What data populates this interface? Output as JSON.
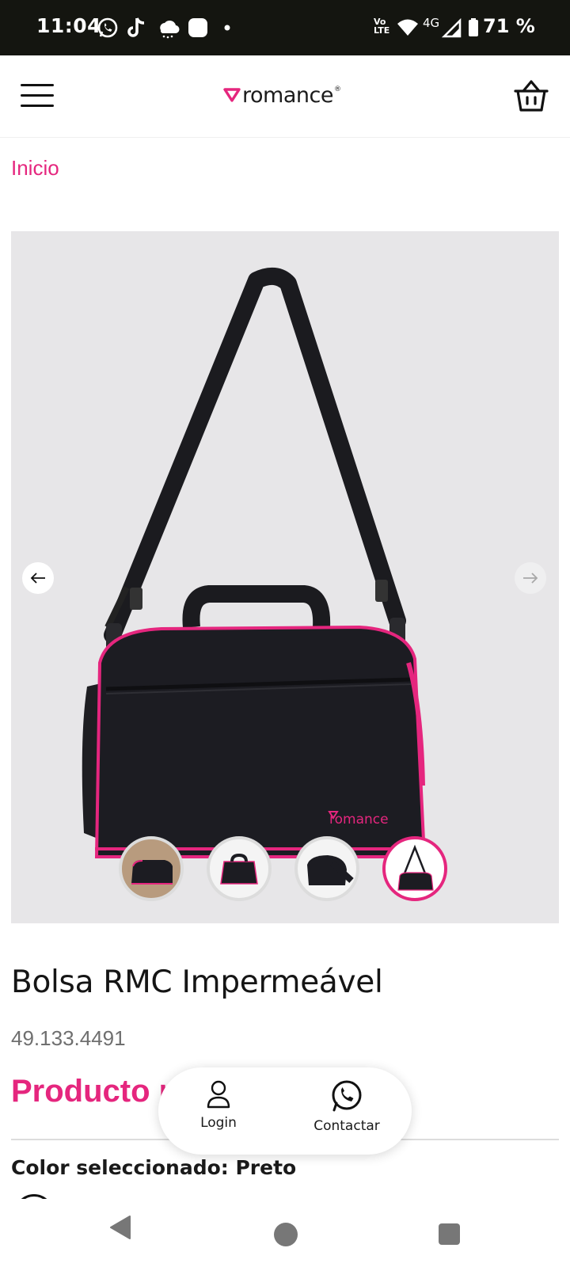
{
  "status_bar": {
    "time": "11:04",
    "network": "4G",
    "volte_top": "Vo",
    "volte_bottom": "LTE",
    "battery": "71 %"
  },
  "header": {
    "brand": "romance",
    "brand_mark": "®",
    "menu_icon": "hamburger-menu-icon",
    "cart_icon": "shopping-basket-icon"
  },
  "breadcrumb": "Inicio",
  "gallery": {
    "thumbnail_count": 4,
    "active_thumbnail": 4,
    "bag_logo": "romance"
  },
  "product": {
    "title": "Bolsa RMC Impermeável",
    "sku": "49.133.4491",
    "status": "Producto r",
    "color_label": "Color seleccionado: ",
    "color_value": "Preto"
  },
  "floating_bar": {
    "login_label": "Login",
    "contact_label": "Contactar"
  },
  "colors": {
    "accent": "#e5267e",
    "status_bar": "#141510",
    "gallery_bg": "#e7e6e8"
  }
}
